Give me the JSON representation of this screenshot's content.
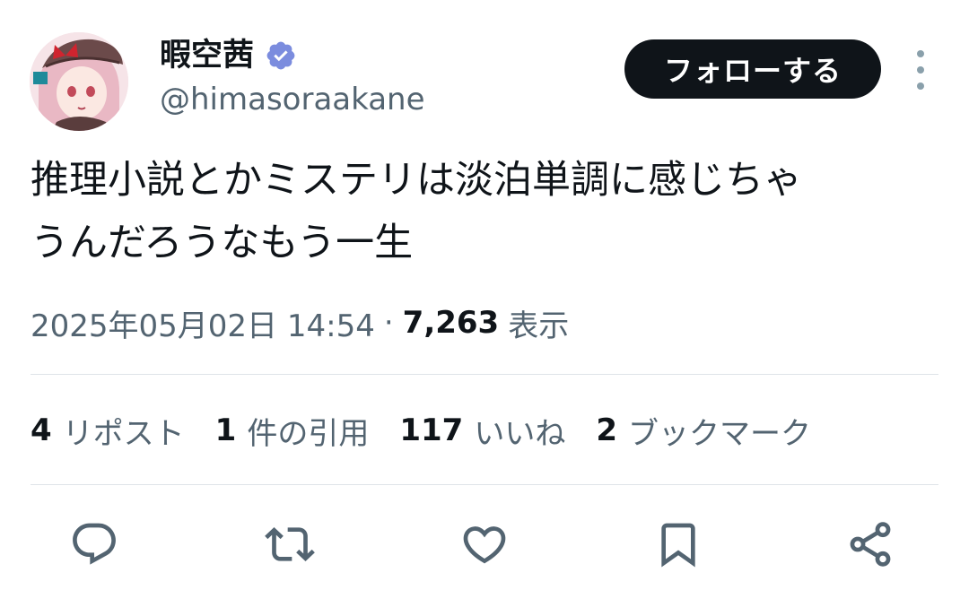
{
  "user": {
    "display_name": "暇空茜",
    "handle": "@himasoraakane",
    "verified": true
  },
  "header": {
    "follow_label": "フォローする"
  },
  "tweet": {
    "text": "推理小説とかミステリは淡泊単調に感じちゃ\nうんだろうなもう一生",
    "timestamp": "2025年05月02日 14:54",
    "separator": "·",
    "views_count": "7,263",
    "views_label": "表示"
  },
  "stats": {
    "reposts_count": "4",
    "reposts_label": "リポスト",
    "quotes_count": "1",
    "quotes_label": "件の引用",
    "likes_count": "117",
    "likes_label": "いいね",
    "bookmarks_count": "2",
    "bookmarks_label": "ブックマーク"
  },
  "actions": [
    {
      "icon": "reply-icon"
    },
    {
      "icon": "repost-icon"
    },
    {
      "icon": "like-icon"
    },
    {
      "icon": "bookmark-icon"
    },
    {
      "icon": "share-icon"
    }
  ],
  "colors": {
    "text_primary": "#0f1419",
    "text_secondary": "#536471",
    "verified_blue": "#7b8cde",
    "follow_button_bg": "#0f1419",
    "divider": "#dfe4e8"
  }
}
